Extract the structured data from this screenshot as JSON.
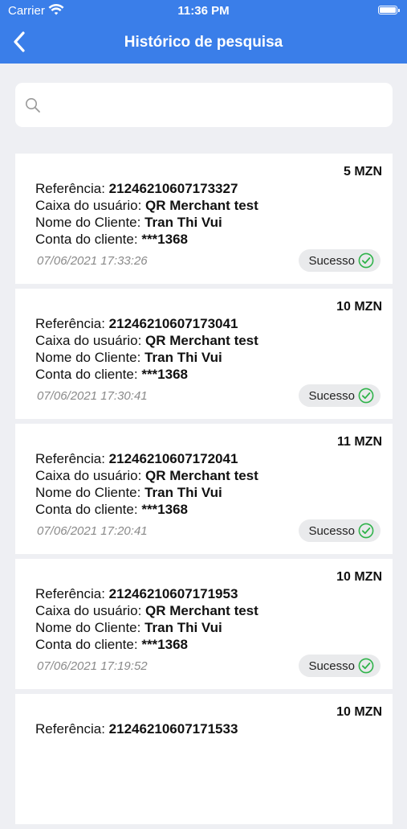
{
  "status_bar": {
    "carrier": "Carrier",
    "time": "11:36 PM"
  },
  "nav": {
    "title": "Histórico de pesquisa"
  },
  "search": {
    "placeholder": "",
    "value": ""
  },
  "transactions": [
    {
      "amount": "5 MZN",
      "reference_label": "Referência:",
      "reference": "21246210607173327",
      "cashier_label": "Caixa do usuário:",
      "cashier": "QR Merchant test",
      "client_name_label": "Nome do Cliente:",
      "client_name": "Tran Thi Vui",
      "client_account_label": "Conta do cliente:",
      "client_account": "***1368",
      "datetime": "07/06/2021 17:33:26",
      "status": "Sucesso"
    },
    {
      "amount": "10 MZN",
      "reference_label": "Referência:",
      "reference": "21246210607173041",
      "cashier_label": "Caixa do usuário:",
      "cashier": "QR Merchant test",
      "client_name_label": "Nome do Cliente:",
      "client_name": "Tran Thi Vui",
      "client_account_label": "Conta do cliente:",
      "client_account": "***1368",
      "datetime": "07/06/2021 17:30:41",
      "status": "Sucesso"
    },
    {
      "amount": "11 MZN",
      "reference_label": "Referência:",
      "reference": "21246210607172041",
      "cashier_label": "Caixa do usuário:",
      "cashier": "QR Merchant test",
      "client_name_label": "Nome do Cliente:",
      "client_name": "Tran Thi Vui",
      "client_account_label": "Conta do cliente:",
      "client_account": "***1368",
      "datetime": "07/06/2021 17:20:41",
      "status": "Sucesso"
    },
    {
      "amount": "10 MZN",
      "reference_label": "Referência:",
      "reference": "21246210607171953",
      "cashier_label": "Caixa do usuário:",
      "cashier": "QR Merchant test",
      "client_name_label": "Nome do Cliente:",
      "client_name": "Tran Thi Vui",
      "client_account_label": "Conta do cliente:",
      "client_account": "***1368",
      "datetime": "07/06/2021 17:19:52",
      "status": "Sucesso"
    },
    {
      "amount": "10 MZN",
      "reference_label": "Referência:",
      "reference": "21246210607171533",
      "cashier_label": "",
      "cashier": "",
      "client_name_label": "",
      "client_name": "",
      "client_account_label": "",
      "client_account": "",
      "datetime": "",
      "status": ""
    }
  ],
  "colors": {
    "header": "#3a7ee9",
    "background": "#eeeff3",
    "success": "#2fb34a"
  },
  "icons": {
    "back": "chevron-left-icon",
    "search": "search-icon",
    "status": "check-circle-icon",
    "wifi": "wifi-icon",
    "battery": "battery-icon"
  }
}
